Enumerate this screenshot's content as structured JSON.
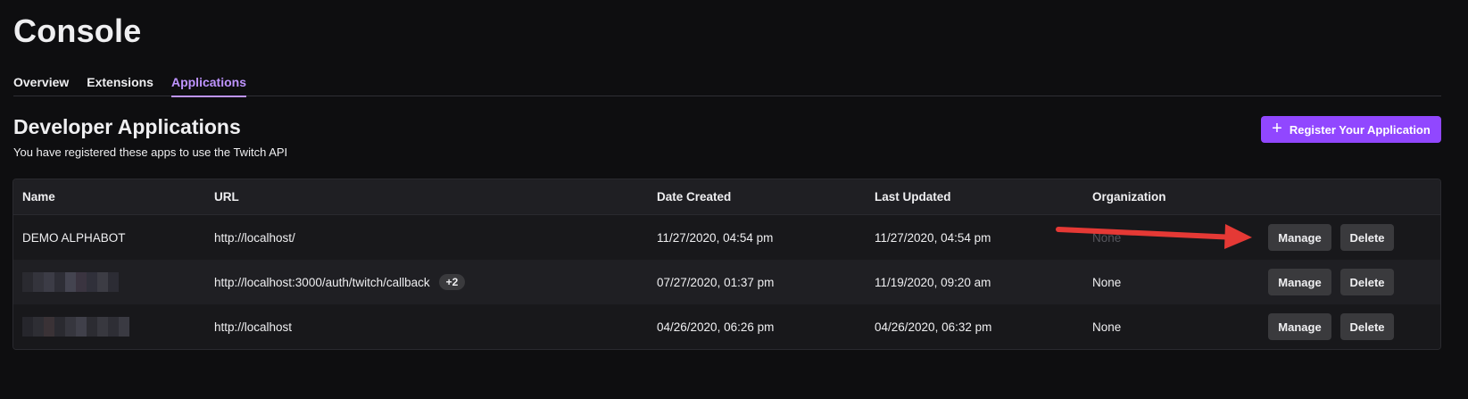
{
  "page": {
    "title": "Console"
  },
  "tabs": [
    {
      "label": "Overview",
      "active": false
    },
    {
      "label": "Extensions",
      "active": false
    },
    {
      "label": "Applications",
      "active": true
    }
  ],
  "section": {
    "title": "Developer Applications",
    "subtitle": "You have registered these apps to use the Twitch API",
    "register_label": "Register Your Application",
    "register_icon": "plus-icon"
  },
  "table": {
    "headers": [
      "Name",
      "URL",
      "Date Created",
      "Last Updated",
      "Organization"
    ],
    "rows": [
      {
        "name": "DEMO ALPHABOT",
        "url": "http://localhost/",
        "url_badge": "",
        "created": "11/27/2020, 04:54 pm",
        "updated": "11/27/2020, 04:54 pm",
        "organization": "None"
      },
      {
        "name": "",
        "url": "http://localhost:3000/auth/twitch/callback",
        "url_badge": "+2",
        "created": "07/27/2020, 01:37 pm",
        "updated": "11/19/2020, 09:20 am",
        "organization": "None"
      },
      {
        "name": "",
        "url": "http://localhost",
        "url_badge": "",
        "created": "04/26/2020, 06:26 pm",
        "updated": "04/26/2020, 06:32 pm",
        "organization": "None"
      }
    ],
    "manage_label": "Manage",
    "delete_label": "Delete"
  },
  "colors": {
    "background": "#0e0e10",
    "accent": "#9147ff",
    "tab_active": "#bf94ff",
    "annotation_arrow": "#e53935"
  }
}
